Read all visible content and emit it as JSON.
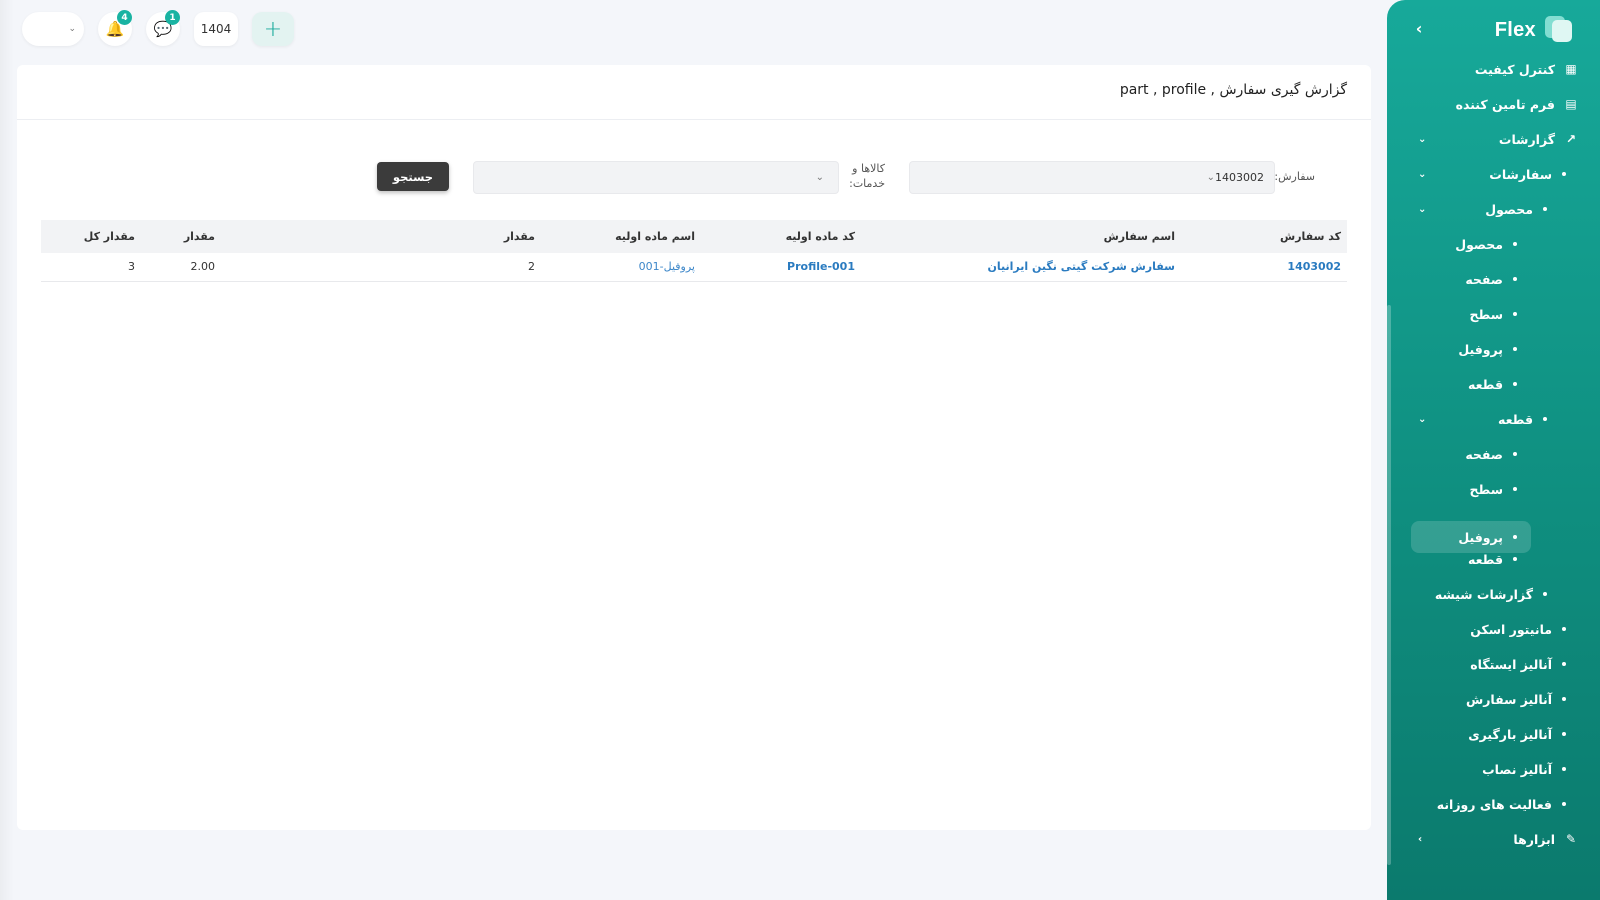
{
  "sidebar": {
    "brand": "Flex",
    "items": [
      {
        "label": "کنترل کیفیت",
        "icon": "table-icon",
        "level": 0
      },
      {
        "label": "فرم تامین کننده",
        "icon": "document-icon",
        "level": 0
      },
      {
        "label": "گزارشات",
        "icon": "chart-line-icon",
        "level": 0,
        "expanded": true
      },
      {
        "label": "سفارشات",
        "level": 1,
        "expanded": true
      },
      {
        "label": "محصول",
        "level": 2,
        "expanded": true
      },
      {
        "label": "محصول",
        "level": 3
      },
      {
        "label": "صفحه",
        "level": 3
      },
      {
        "label": "سطح",
        "level": 3
      },
      {
        "label": "پروفیل",
        "level": 3
      },
      {
        "label": "قطعه",
        "level": 3
      },
      {
        "label": "قطعه",
        "level": 2,
        "expanded": true
      },
      {
        "label": "صفحه",
        "level": 3
      },
      {
        "label": "سطح",
        "level": 3
      },
      {
        "label": "پروفیل",
        "level": 3,
        "active": true
      },
      {
        "label": "قطعه",
        "level": 3
      },
      {
        "label": "گزارشات شیشه",
        "level": 2
      },
      {
        "label": "مانیتور اسکن",
        "level": 1
      },
      {
        "label": "آنالیز ایستگاه",
        "level": 1
      },
      {
        "label": "آنالیز سفارش",
        "level": 1
      },
      {
        "label": "آنالیز بارگیری",
        "level": 1
      },
      {
        "label": "آنالیز نصاب",
        "level": 1
      },
      {
        "label": "فعالیت های روزانه",
        "level": 1
      },
      {
        "label": "ابزارها",
        "icon": "pencil-icon",
        "level": 0
      }
    ]
  },
  "topbar": {
    "year": "1404",
    "notifications_count": "4",
    "messages_count": "1"
  },
  "page": {
    "title": "گزارش گیری سفارش , part , profile"
  },
  "filters": {
    "order_label": "سفارش:",
    "order_value": "1403002",
    "goods_label_line1": "کالاها و",
    "goods_label_line2": "خدمات:",
    "goods_value": "",
    "search_label": "جستجو"
  },
  "table": {
    "headers": [
      "کد سفارش",
      "اسم سفارش",
      "کد ماده اولیه",
      "اسم ماده اولیه",
      "مقدار",
      "مقدار",
      "مقدار کل"
    ],
    "rows": [
      [
        "1403002",
        "سفارش شرکت گیتی نگین ایرانیان",
        "Profile-001",
        "پروفیل-001",
        "2",
        "2.00",
        "3"
      ]
    ]
  },
  "colors": {
    "sidebar": "#17a99a",
    "accent": "#19b3a2",
    "link": "#2a7bc0",
    "button": "#3b3b3b"
  }
}
